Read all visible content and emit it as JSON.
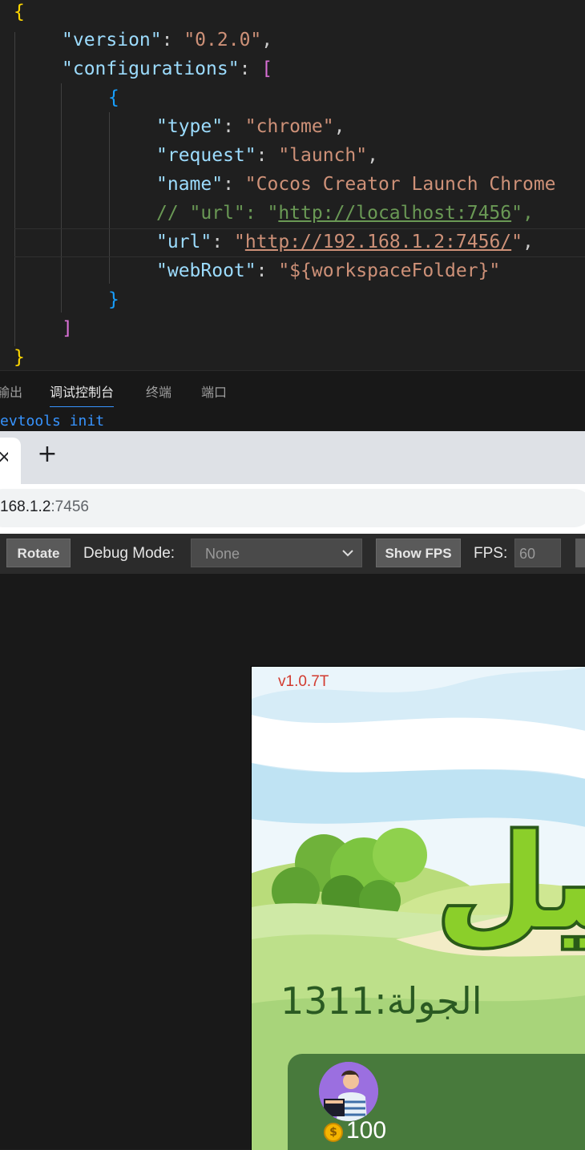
{
  "editor": {
    "lines": {
      "l1": "{",
      "l2_key": "\"version\"",
      "l2_val": "\"0.2.0\"",
      "l3_key": "\"configurations\"",
      "l3_bracket": "[",
      "l4": "{",
      "l5_key": "\"type\"",
      "l5_val": "\"chrome\"",
      "l6_key": "\"request\"",
      "l6_val": "\"launch\"",
      "l7_key": "\"name\"",
      "l7_val": "\"Cocos Creator Launch Chrome",
      "l8_comment_a": "// \"url\": \"",
      "l8_comment_link": "http://localhost:7456",
      "l8_comment_b": "\",",
      "l9_key": "\"url\"",
      "l9_q1": "\"",
      "l9_link": "http://192.168.1.2:7456/",
      "l9_q2": "\"",
      "l10_key": "\"webRoot\"",
      "l10_val": "\"${workspaceFolder}\"",
      "l11": "}",
      "l12": "]",
      "l13": "}"
    },
    "colon": ": ",
    "comma": ","
  },
  "panel": {
    "tabs": [
      "输出",
      "调试控制台",
      "终端",
      "端口"
    ],
    "active_tab": "调试控制台",
    "console_text": "evtools init"
  },
  "browser": {
    "close_glyph": "×",
    "new_tab_glyph": "+",
    "url_host": "168.1.2",
    "url_port": ":7456"
  },
  "toolbar": {
    "rotate_label": "Rotate",
    "debug_mode_label": "Debug Mode:",
    "debug_mode_value": "None",
    "show_fps_label": "Show FPS",
    "fps_label": "FPS:",
    "fps_value": "60"
  },
  "game": {
    "version": "v1.0.7T",
    "title_fragment": "ـيل",
    "round_label": "الجولة:1311",
    "coin_symbol": "$",
    "coins": "100"
  },
  "colors": {
    "editor_bg": "#1f1f1f",
    "json_key": "#9cdcfe",
    "json_string": "#ce9178",
    "comment": "#6a9955",
    "bracket_gold": "#ffd700",
    "bracket_purple": "#da70d6",
    "bracket_blue": "#179fff",
    "accent_blue": "#3794ff"
  },
  "icons": [
    "close-icon",
    "plus-icon",
    "chevron-down-icon",
    "coin-icon",
    "avatar"
  ]
}
